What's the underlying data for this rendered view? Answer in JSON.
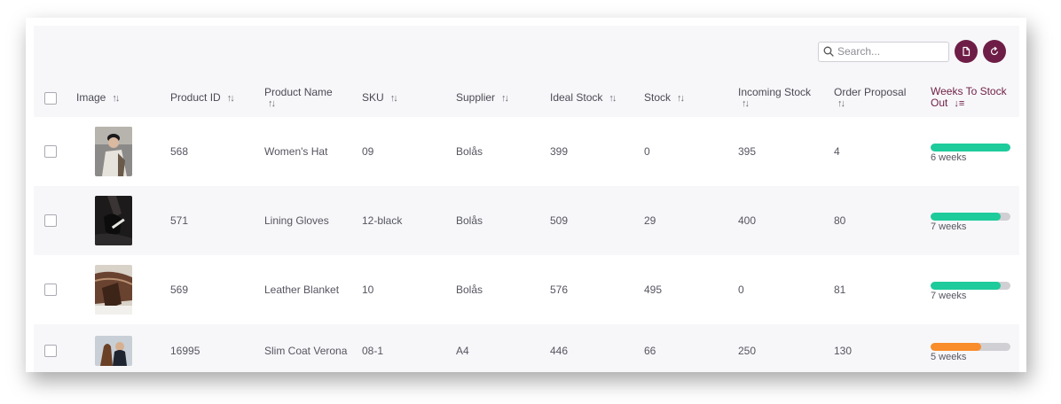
{
  "toolbar": {
    "search_placeholder": "Search...",
    "export_icon": "document-icon",
    "refresh_icon": "refresh-icon",
    "accent_color": "#6e1e46"
  },
  "columns": [
    {
      "key": "image",
      "label": "Image"
    },
    {
      "key": "product_id",
      "label": "Product ID"
    },
    {
      "key": "product_name",
      "label": "Product Name"
    },
    {
      "key": "sku",
      "label": "SKU"
    },
    {
      "key": "supplier",
      "label": "Supplier"
    },
    {
      "key": "ideal_stock",
      "label": "Ideal Stock"
    },
    {
      "key": "stock",
      "label": "Stock"
    },
    {
      "key": "incoming_stock",
      "label": "Incoming Stock"
    },
    {
      "key": "order_proposal",
      "label": "Order Proposal"
    },
    {
      "key": "weeks_to_stock_out",
      "label": "Weeks To Stock Out"
    }
  ],
  "rows": [
    {
      "product_id": "568",
      "product_name": "Women's Hat",
      "sku": "09",
      "supplier": "Bolås",
      "ideal_stock": "399",
      "stock": "0",
      "incoming_stock": "395",
      "order_proposal": "4",
      "weeks_label": "6 weeks",
      "weeks_fraction": 1.0,
      "bar_color": "#1ecb9b"
    },
    {
      "product_id": "571",
      "product_name": "Lining Gloves",
      "sku": "12-black",
      "supplier": "Bolås",
      "ideal_stock": "509",
      "stock": "29",
      "incoming_stock": "400",
      "order_proposal": "80",
      "weeks_label": "7 weeks",
      "weeks_fraction": 0.88,
      "bar_color": "#1ecb9b"
    },
    {
      "product_id": "569",
      "product_name": "Leather Blanket",
      "sku": "10",
      "supplier": "Bolås",
      "ideal_stock": "576",
      "stock": "495",
      "incoming_stock": "0",
      "order_proposal": "81",
      "weeks_label": "7 weeks",
      "weeks_fraction": 0.88,
      "bar_color": "#1ecb9b"
    },
    {
      "product_id": "16995",
      "product_name": "Slim Coat Verona",
      "sku": "08-1",
      "supplier": "A4",
      "ideal_stock": "446",
      "stock": "66",
      "incoming_stock": "250",
      "order_proposal": "130",
      "weeks_label": "5 weeks",
      "weeks_fraction": 0.63,
      "bar_color": "#f98c2b"
    }
  ]
}
